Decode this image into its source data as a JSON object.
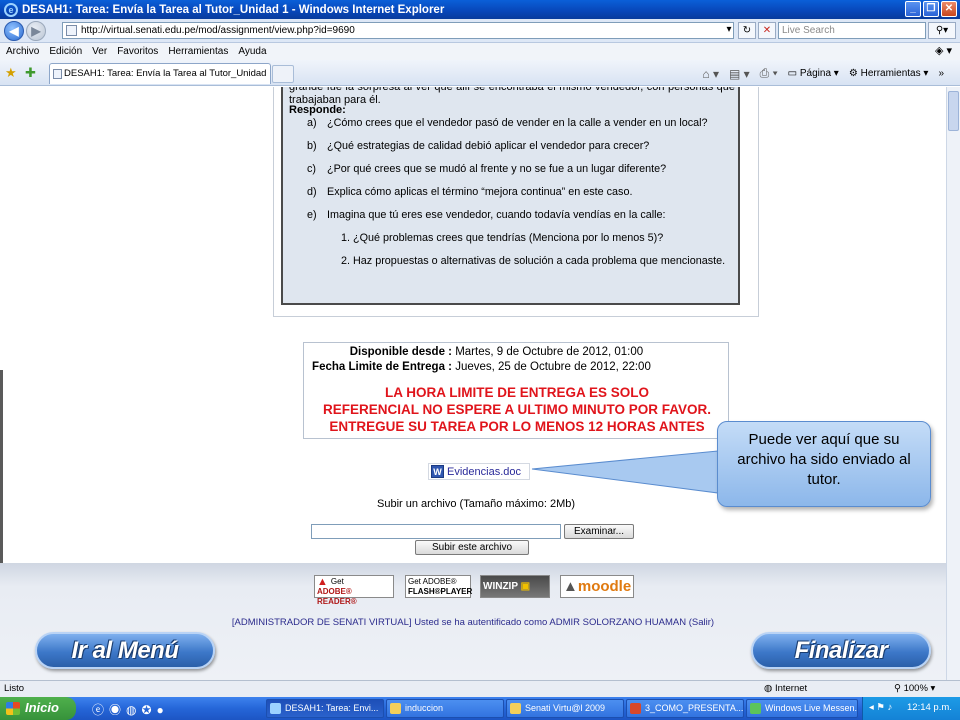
{
  "window": {
    "title": "DESAH1: Tarea: Envía la Tarea al Tutor_Unidad 1 - Windows Internet Explorer"
  },
  "address": {
    "url": "http://virtual.senati.edu.pe/mod/assignment/view.php?id=9690",
    "search_placeholder": "Live Search"
  },
  "menu": {
    "items": [
      "Archivo",
      "Edición",
      "Ver",
      "Favoritos",
      "Herramientas",
      "Ayuda"
    ]
  },
  "tabs": {
    "active_label": "DESAH1: Tarea: Envía la Tarea al Tutor_Unidad 1"
  },
  "commandbar": {
    "page_label": "Página",
    "tools_label": "Herramientas"
  },
  "assignment": {
    "intro_text": "grande fue la sorpresa al ver que allí se encontraba el mismo vendedor, con personas que trabajaban para él.",
    "responde_label": "Responde:",
    "questions": [
      {
        "letter": "a)",
        "text": "¿Cómo crees que el vendedor pasó de vender en la calle a vender en un local?"
      },
      {
        "letter": "b)",
        "text": "¿Qué estrategias de calidad debió aplicar el vendedor para crecer?"
      },
      {
        "letter": "c)",
        "text": "¿Por qué crees que se mudó al frente y no se fue a un lugar diferente?"
      },
      {
        "letter": "d)",
        "text": "Explica cómo aplicas el término “mejora continua” en este caso."
      },
      {
        "letter": "e)",
        "text": "Imagina que tú eres ese vendedor, cuando todavía vendías en la calle:"
      }
    ],
    "subquestions": [
      "1. ¿Qué problemas crees que tendrías (Menciona por lo menos 5)?",
      "2. Haz propuestas o alternativas de solución a cada problema que mencionaste."
    ]
  },
  "dates": {
    "available_label": "Disponible desde :",
    "available_value": "Martes, 9 de Octubre de 2012, 01:00",
    "due_label": "Fecha Limite de Entrega :",
    "due_value": "Jueves, 25 de Octubre de 2012, 22:00",
    "warning_lines": [
      "LA HORA LIMITE DE ENTREGA ES SOLO",
      "REFERENCIAL NO ESPERE A ULTIMO MINUTO POR FAVOR.",
      "ENTREGUE SU TAREA POR LO MENOS 12 HORAS ANTES"
    ],
    "warning_color": "#e0141b"
  },
  "upload": {
    "submitted_file": "Evidencias.doc",
    "upload_label": "Subir un archivo (Tamaño máximo: 2Mb)",
    "browse_button": "Examinar...",
    "submit_button": "Subir este archivo"
  },
  "callout": {
    "text": "Puede ver aquí que su archivo ha sido enviado al tutor."
  },
  "footer": {
    "badges": [
      {
        "line1": "Get",
        "line2": "ADOBE® READER®"
      },
      {
        "line1": "Get ADOBE®",
        "line2": "FLASH®PLAYER"
      },
      {
        "line1": "WINZIP",
        "line2": ""
      },
      {
        "line1": "moodle",
        "line2": ""
      }
    ],
    "login_text": "[ADMINISTRADOR DE SENATI VIRTUAL] Usted se ha autentificado como ADMIR SOLORZANO HUAMAN (Salir)"
  },
  "nav_buttons": {
    "menu_label": "Ir al Menú",
    "finish_label": "Finalizar"
  },
  "statusbar": {
    "status": "Listo",
    "zone": "Internet",
    "zoom": "100%"
  },
  "taskbar": {
    "start_label": "Inicio",
    "items": [
      "DESAH1: Tarea: Envi...",
      "induccion",
      "Senati Virtu@l 2009",
      "3_COMO_PRESENTA...",
      "Windows Live Messen..."
    ],
    "clock": "12:14 p.m."
  }
}
